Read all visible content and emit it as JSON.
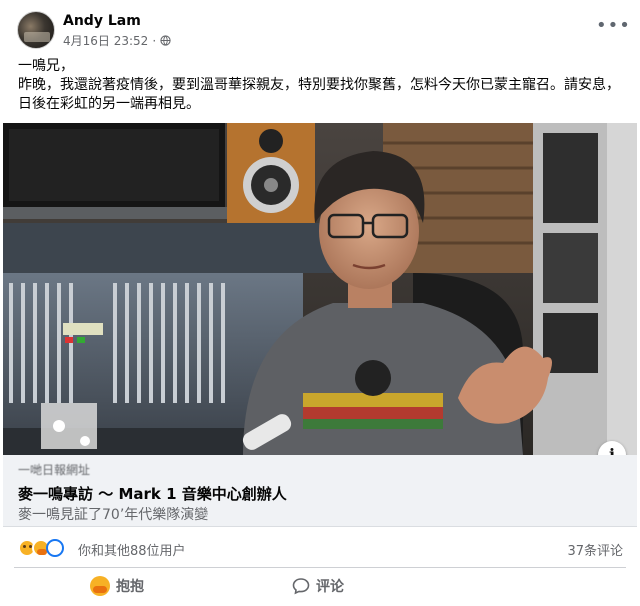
{
  "post": {
    "author": "Andy Lam",
    "timestamp": "4月16日 23:52",
    "separator": "·",
    "more_icon": "more-dots-icon",
    "privacy_icon": "globe-icon",
    "text_lines": [
      "一鳴兄，",
      "昨晚，我還說著疫情後，要到溫哥華探親友，特別要找你聚舊，怎料今天你已蒙主寵召。請安息，",
      "日後在彩虹的另一端再相見。"
    ]
  },
  "link_preview": {
    "domain": "一哋日報網址",
    "title": "麥一鳴專訪 ～ Mark 1 音樂中心創辦人",
    "description": "麥一鳴見証了70’年代樂隊演變",
    "info_label": "i"
  },
  "reactions": {
    "summary": "你和其他88位用户",
    "comments": "37条评论",
    "icons": [
      "sad-reaction-icon",
      "care-reaction-icon",
      "loading-reaction-icon"
    ]
  },
  "actions": {
    "hug_label": "抱抱",
    "comment_label": "评论"
  },
  "colors": {
    "accent": "#1877f2",
    "secondary_text": "#65676b",
    "card_bg": "#f0f2f5"
  }
}
